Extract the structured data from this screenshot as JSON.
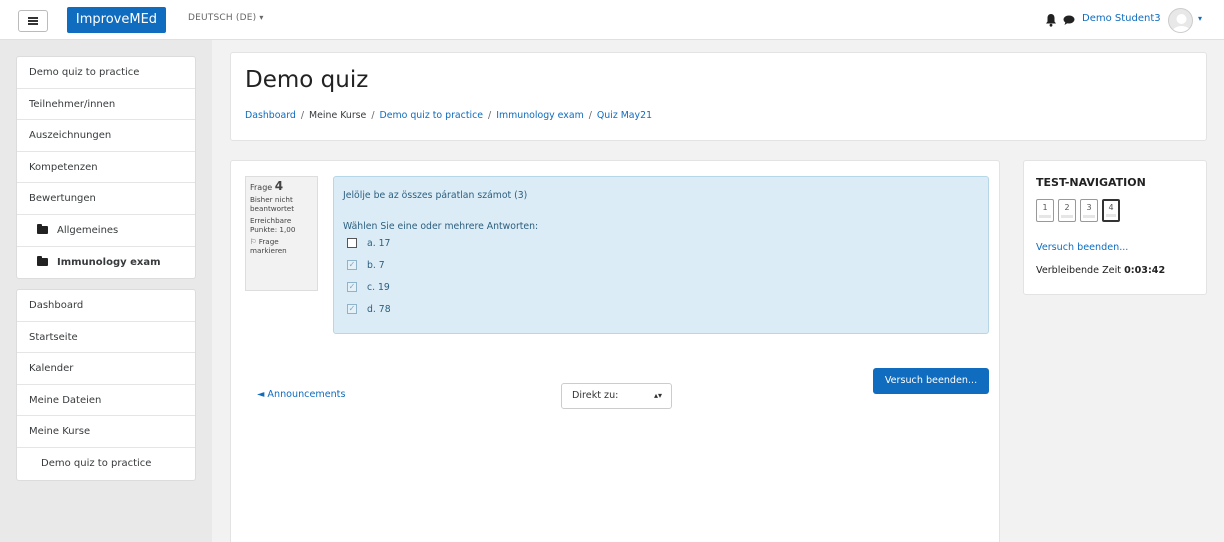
{
  "navbar": {
    "brand": "ImproveMEd",
    "language": "DEUTSCH (DE)",
    "username": "Demo Student3",
    "icons": [
      "menu-icon",
      "bell-icon",
      "chat-icon",
      "avatar-icon"
    ]
  },
  "sidebar": {
    "course_items": [
      {
        "label": "Demo quiz to practice"
      },
      {
        "label": "Teilnehmer/innen"
      },
      {
        "label": "Auszeichnungen"
      },
      {
        "label": "Kompetenzen"
      },
      {
        "label": "Bewertungen"
      },
      {
        "label": "Allgemeines"
      },
      {
        "label": "Immunology exam"
      }
    ],
    "site_items": [
      {
        "label": "Dashboard"
      },
      {
        "label": "Startseite"
      },
      {
        "label": "Kalender"
      },
      {
        "label": "Meine Dateien"
      },
      {
        "label": "Meine Kurse"
      },
      {
        "label": "Demo quiz to practice"
      }
    ]
  },
  "header": {
    "title": "Demo quiz",
    "breadcrumb": [
      "Dashboard",
      "Meine Kurse",
      "Demo quiz to practice",
      "Immunology exam",
      "Quiz May21"
    ]
  },
  "question": {
    "info_label": "Frage",
    "number": "4",
    "status": "Bisher nicht beantwortet",
    "points": "Erreichbare Punkte: 1,00",
    "flag": "Frage markieren",
    "text": "Jelölje be az összes páratlan számot (3)",
    "prompt": "Wählen Sie eine oder mehrere Antworten:",
    "answers": [
      {
        "label": "a. 17",
        "checked": false
      },
      {
        "label": "b. 7",
        "checked": true
      },
      {
        "label": "c. 19",
        "checked": true
      },
      {
        "label": "d. 78",
        "checked": true
      }
    ]
  },
  "footer": {
    "prev_link": "◄ Announcements",
    "jump_label": "Direkt zu:",
    "finish_button": "Versuch beenden..."
  },
  "testnav": {
    "title": "TEST-NAVIGATION",
    "buttons": [
      "1",
      "2",
      "3",
      "4"
    ],
    "current": "4",
    "finish_link": "Versuch beenden...",
    "timer_label": "Verbleibende Zeit",
    "timer_value": "0:03:42"
  }
}
